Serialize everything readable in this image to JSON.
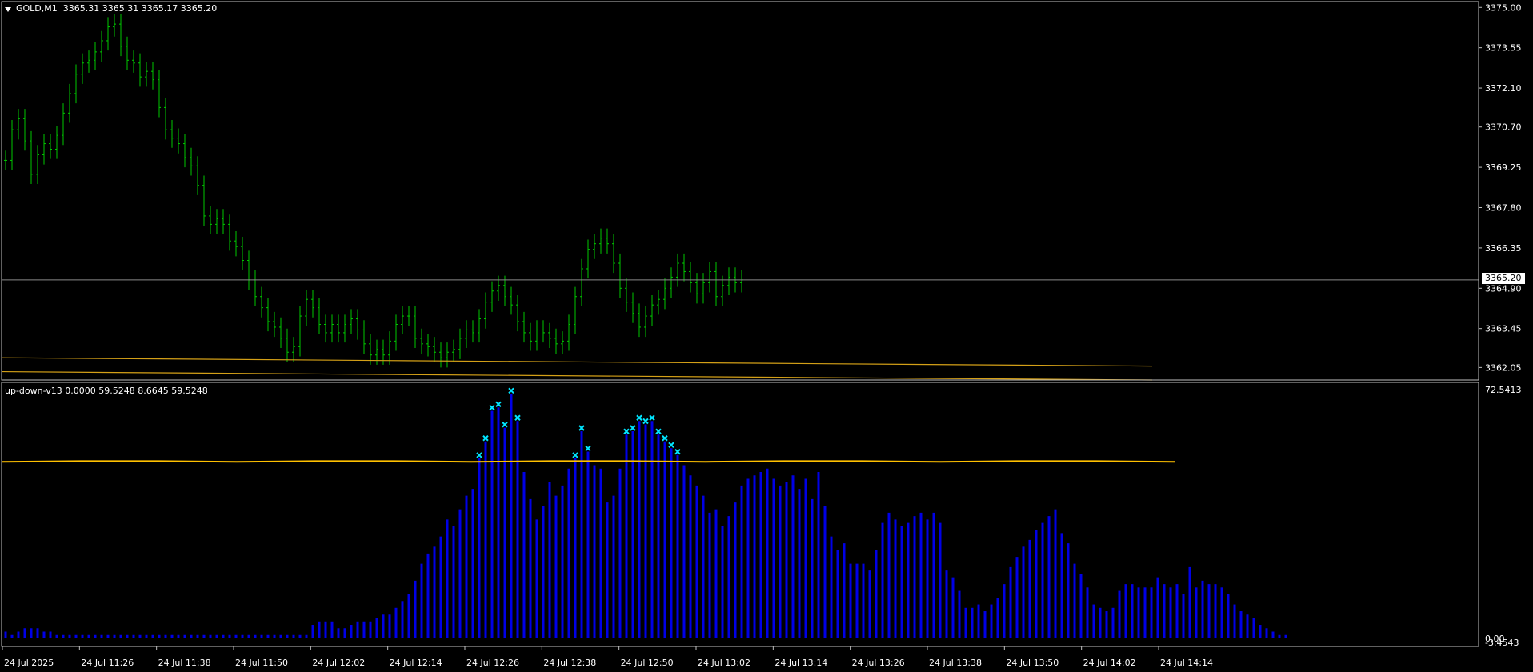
{
  "chart_header": {
    "symbol": "GOLD,M1",
    "ohlc": "3365.31 3365.31 3365.17 3365.20"
  },
  "indicator_header": {
    "name": "up-down-v13",
    "values": "0.0000 59.5248 8.6645 59.5248"
  },
  "price_axis": {
    "ticks": [
      "3375.00",
      "3373.55",
      "3372.10",
      "3370.70",
      "3369.25",
      "3367.80",
      "3366.35",
      "3364.90",
      "3363.45",
      "3362.05"
    ],
    "current_price": "3365.20"
  },
  "indicator_axis": {
    "max_label": "72.5413",
    "zero_label": "0.00",
    "min_label": "-3.4543"
  },
  "time_axis": {
    "labels": [
      "24 Jul 2025",
      "24 Jul 11:26",
      "24 Jul 11:38",
      "24 Jul 11:50",
      "24 Jul 12:02",
      "24 Jul 12:14",
      "24 Jul 12:26",
      "24 Jul 12:38",
      "24 Jul 12:50",
      "24 Jul 13:02",
      "24 Jul 13:14",
      "24 Jul 13:26",
      "24 Jul 13:38",
      "24 Jul 13:50",
      "24 Jul 14:02",
      "24 Jul 14:14"
    ]
  },
  "colors": {
    "background": "#000000",
    "candle": "#00c800",
    "histogram": "#0000e6",
    "signal_line": "#ffc000",
    "ma_line": "#d4a017",
    "markers": "#00e5ff",
    "axis": "#c0c0c0",
    "text": "#ffffff"
  },
  "chart_data": [
    {
      "type": "line",
      "series": [
        {
          "values": [
            3369.5,
            3370.6,
            3371.0,
            3370.2,
            3369.0,
            3369.7,
            3370.1,
            3369.9,
            3370.4,
            3371.2,
            3371.9,
            3372.6,
            3373.0,
            3373.1,
            3373.4,
            3373.8,
            3374.3,
            3374.4,
            3373.6,
            3373.1,
            3373.0,
            3372.5,
            3372.7,
            3372.4,
            3371.4,
            3370.6,
            3370.3,
            3370.1,
            3369.6,
            3369.3,
            3368.6,
            3367.5,
            3367.2,
            3367.4,
            3367.2,
            3366.6,
            3366.4,
            3365.9,
            3365.2,
            3364.6,
            3364.2,
            3363.7,
            3363.5,
            3363.1,
            3362.6,
            3362.8,
            3363.9,
            3364.5,
            3364.2,
            3363.6,
            3363.3,
            3363.6,
            3363.3,
            3363.6,
            3363.8,
            3363.4,
            3362.9,
            3362.5,
            3362.7,
            3362.5,
            3363.0,
            3363.6,
            3363.9,
            3363.9,
            3363.1,
            3362.9,
            3362.8,
            3362.6,
            3362.4,
            3362.6,
            3362.7,
            3363.1,
            3363.4,
            3363.3,
            3363.8,
            3364.4,
            3364.8,
            3365.0,
            3364.6,
            3364.3,
            3363.7,
            3363.3,
            3363.0,
            3363.4,
            3363.3,
            3363.1,
            3362.9,
            3363.0,
            3363.6,
            3364.6,
            3365.6,
            3366.3,
            3366.5,
            3366.7,
            3366.5,
            3365.8,
            3364.9,
            3364.4,
            3364.0,
            3363.5,
            3363.9,
            3364.3,
            3364.5,
            3364.9,
            3365.3,
            3365.8,
            3365.5,
            3365.1,
            3364.7,
            3365.1,
            3365.5,
            3364.6,
            3365.0,
            3365.3,
            3365.1,
            3365.2
          ]
        },
        {
          "values": [
            3362.4,
            3362.3,
            3362.2,
            3362.1
          ]
        },
        {
          "values": [
            3361.9,
            3361.8,
            3361.7,
            3361.6
          ]
        }
      ]
    },
    {
      "type": "bar",
      "series": [
        {
          "values": [
            2,
            1,
            2,
            3,
            3,
            3,
            2,
            2,
            1,
            1,
            1,
            1,
            1,
            1,
            1,
            1,
            1,
            1,
            1,
            1,
            1,
            1,
            1,
            1,
            1,
            1,
            1,
            1,
            1,
            1,
            1,
            1,
            1,
            1,
            1,
            1,
            1,
            1,
            1,
            1,
            1,
            1,
            1,
            1,
            1,
            1,
            1,
            1,
            4,
            5,
            5,
            5,
            3,
            3,
            4,
            5,
            5,
            5,
            6,
            7,
            7,
            9,
            11,
            13,
            17,
            22,
            25,
            27,
            30,
            35,
            33,
            38,
            42,
            44,
            53,
            58,
            67,
            68,
            62,
            72,
            64,
            49,
            41,
            35,
            39,
            46,
            42,
            45,
            50,
            53,
            61,
            55,
            51,
            50,
            40,
            42,
            50,
            60,
            61,
            64,
            63,
            64,
            60,
            58,
            56,
            54,
            51,
            48,
            45,
            42,
            37,
            38,
            33,
            36,
            40,
            45,
            47,
            48,
            49,
            50,
            47,
            45,
            46,
            48,
            44,
            47,
            41,
            49,
            39,
            30,
            26,
            28,
            22,
            22,
            22,
            20,
            26,
            34,
            37,
            35,
            33,
            34,
            36,
            37,
            35,
            37,
            34,
            20,
            18,
            14,
            9,
            9,
            10,
            8,
            10,
            12,
            16,
            21,
            24,
            27,
            29,
            32,
            34,
            36,
            38,
            31,
            28,
            22,
            19,
            15,
            10,
            9,
            8,
            9,
            14,
            16,
            16,
            15,
            15,
            15,
            18,
            16,
            15,
            16,
            13,
            21,
            15,
            17,
            16,
            16,
            15,
            13,
            10,
            8,
            7,
            6,
            4,
            3,
            2,
            1,
            1
          ]
        },
        {
          "values": [
            52,
            52,
            52,
            52,
            52,
            52,
            52,
            52,
            52,
            52,
            52,
            52,
            52,
            52,
            52,
            52
          ]
        }
      ],
      "ylim": [
        -3.4543,
        72.5413
      ]
    }
  ]
}
